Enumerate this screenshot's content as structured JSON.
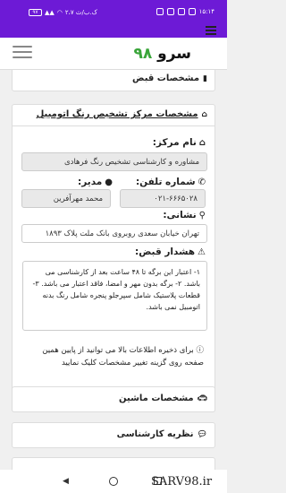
{
  "status_bar": {
    "time": "۱۵:۱۴",
    "battery": "۹۷",
    "speed": "۲،۷ ک.ب/ث"
  },
  "app": {
    "logo_text": "سرو",
    "logo_number": "۹۸"
  },
  "panels": {
    "receipt": {
      "title": "مشخصات قبض"
    },
    "center": {
      "title": "مشخصات مرکز تشخیص رنگ اتومبیل",
      "center_name_label": "نام مرکز:",
      "center_name_value": "مشاوره و کارشناسی تشخیص رنگ فرهادی",
      "phone_label": "شماره تلفن:",
      "phone_value": "۰۲۱-۶۶۶۵۰۲۸",
      "manager_label": "مدیر:",
      "manager_value": "محمد مهرآفرین",
      "address_label": "نشانی:",
      "address_value": "تهران خیابان سعدی روبروی بانک ملت پلاک ۱۸۹۳",
      "warning_label": "هشدار قبض:",
      "warning_text": "۱- اعتبار این برگه تا ۴۸ ساعت بعد از کارشناسی می باشد. ۲- برگه بدون مهر و امضا، فاقد اعتبار می باشد. ۳- قطعات پلاستیک شامل سپرجلو پنجره شامل رنگ بدنه اتومبیل نمی باشد.",
      "info_note": "برای ذخیره اطلاعات بالا می توانید از پایین همین صفحه روی گزینه تغییر مشخصات کلیک نمایید"
    },
    "car": {
      "title": "مشخصات ماشین"
    },
    "expert": {
      "title": "نظریه کارشناسی"
    }
  },
  "watermark": "SARV98.ir",
  "icons": {
    "receipt": "book-icon",
    "center": "home-icon",
    "name": "home-icon",
    "phone": "phone-icon",
    "manager": "user-icon",
    "address": "map-marker-icon",
    "warning": "warning-icon",
    "info": "info-circle-icon",
    "car": "car-icon",
    "expert": "comment-icon"
  },
  "colors": {
    "status_bar": "#6d1ad6",
    "logo_accent": "#3aa53a"
  }
}
